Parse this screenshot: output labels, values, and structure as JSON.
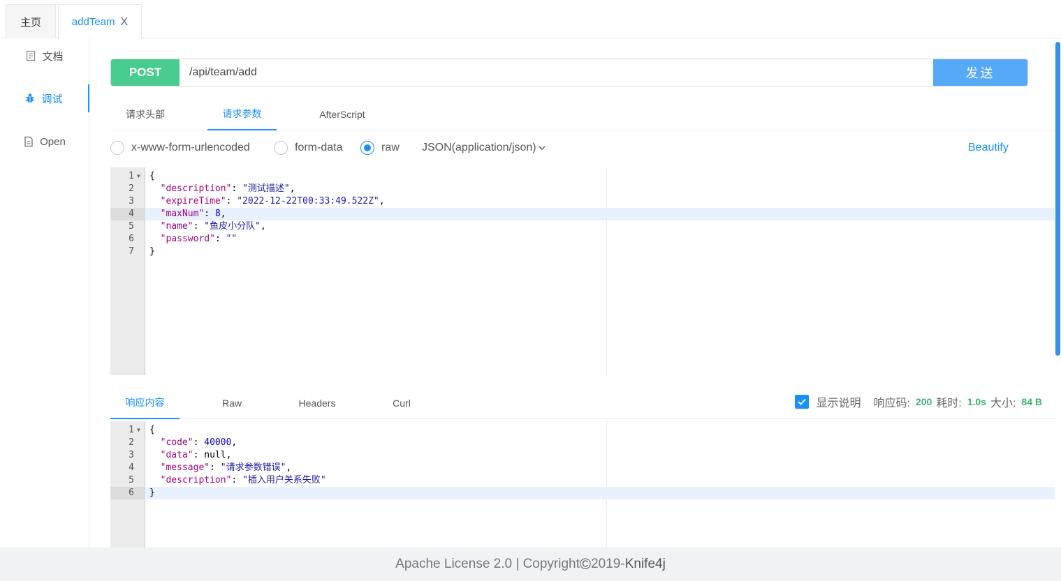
{
  "tabs": {
    "home": "主页",
    "active": "addTeam",
    "close": "X"
  },
  "nav": {
    "doc": "文档",
    "debug": "调试",
    "open": "Open"
  },
  "request": {
    "method": "POST",
    "url": "/api/team/add",
    "send": "发送"
  },
  "subtabs": [
    "请求头部",
    "请求参数",
    "AfterScript"
  ],
  "body_types": {
    "urlencoded": "x-www-form-urlencoded",
    "formdata": "form-data",
    "raw": "raw",
    "content_type": "JSON(application/json)",
    "beautify": "Beautify"
  },
  "request_body": [
    {
      "num": "1",
      "code": "{"
    },
    {
      "num": "2",
      "key": "\"description\"",
      "val": "\"测试描述\"",
      "tail": ","
    },
    {
      "num": "3",
      "key": "\"expireTime\"",
      "val": "\"2022-12-22T00:33:49.522Z\"",
      "tail": ","
    },
    {
      "num": "4",
      "key": "\"maxNum\"",
      "num_val": "8",
      "tail": ","
    },
    {
      "num": "5",
      "key": "\"name\"",
      "val": "\"鱼皮小分队\"",
      "tail": ","
    },
    {
      "num": "6",
      "key": "\"password\"",
      "val": "\"\"",
      "tail": ""
    },
    {
      "num": "7",
      "code": "}"
    }
  ],
  "response_tabs": [
    "响应内容",
    "Raw",
    "Headers",
    "Curl"
  ],
  "response_meta": {
    "show_desc": "显示说明",
    "code_label": "响应码:",
    "code_value": "200",
    "time_label": "耗时:",
    "time_value": "1.0s",
    "size_label": "大小:",
    "size_value": "84 B"
  },
  "response_body": [
    {
      "num": "1",
      "code": "{"
    },
    {
      "num": "2",
      "key": "\"code\"",
      "num_val": "40000",
      "tail": ","
    },
    {
      "num": "3",
      "key": "\"data\"",
      "plain": "null",
      "tail": ","
    },
    {
      "num": "4",
      "key": "\"message\"",
      "val": "\"请求参数错误\"",
      "tail": ","
    },
    {
      "num": "5",
      "key": "\"description\"",
      "val": "\"插入用户关系失败\"",
      "tail": ""
    },
    {
      "num": "6",
      "code": "}"
    }
  ],
  "footer": {
    "text": "Apache License 2.0 | Copyright ",
    "copyright": "©",
    "year": " 2019-",
    "brand": "Knife4j"
  },
  "colors": {
    "accent": "#1890ff",
    "post": "#49cc90",
    "send": "#55a9f6",
    "status_ok": "#3cb371"
  }
}
